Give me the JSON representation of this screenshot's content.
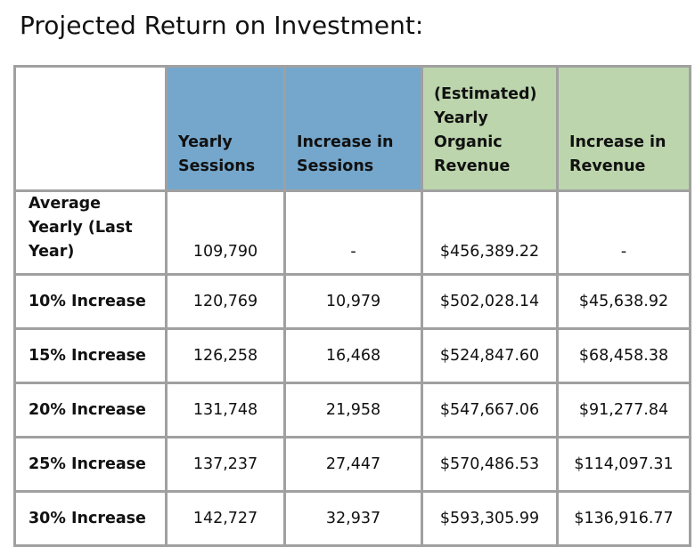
{
  "title": "Projected Return on Investment:",
  "colors": {
    "sessions_header": "#75a7cc",
    "revenue_header": "#bcd5ac",
    "grid": "#a0a0a0"
  },
  "table": {
    "headers": [
      "",
      "Yearly Sessions",
      "Increase in Sessions",
      "(Estimated) Yearly Organic Revenue",
      "Increase in Revenue"
    ],
    "rows": [
      {
        "label": "Average Yearly (Last Year)",
        "yearly_sessions": "109,790",
        "increase_sessions": "-",
        "yearly_revenue": "$456,389.22",
        "increase_revenue": "-"
      },
      {
        "label": "10% Increase",
        "yearly_sessions": "120,769",
        "increase_sessions": "10,979",
        "yearly_revenue": "$502,028.14",
        "increase_revenue": "$45,638.92"
      },
      {
        "label": "15% Increase",
        "yearly_sessions": "126,258",
        "increase_sessions": "16,468",
        "yearly_revenue": "$524,847.60",
        "increase_revenue": "$68,458.38"
      },
      {
        "label": "20% Increase",
        "yearly_sessions": "131,748",
        "increase_sessions": "21,958",
        "yearly_revenue": "$547,667.06",
        "increase_revenue": "$91,277.84"
      },
      {
        "label": "25% Increase",
        "yearly_sessions": "137,237",
        "increase_sessions": "27,447",
        "yearly_revenue": "$570,486.53",
        "increase_revenue": "$114,097.31"
      },
      {
        "label": "30% Increase",
        "yearly_sessions": "142,727",
        "increase_sessions": "32,937",
        "yearly_revenue": "$593,305.99",
        "increase_revenue": "$136,916.77"
      }
    ]
  }
}
